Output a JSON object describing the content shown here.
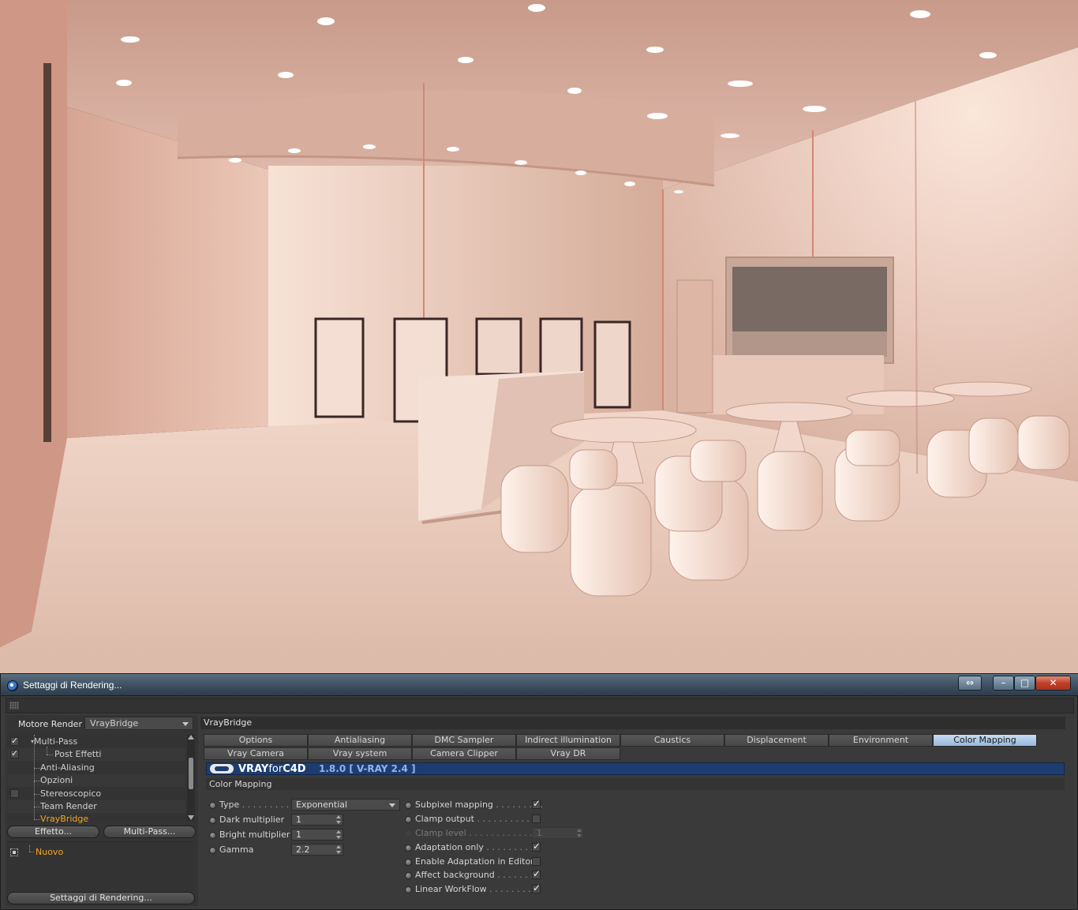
{
  "window": {
    "title": "Settaggi di Rendering..."
  },
  "left_panel": {
    "engine_label": "Motore Render",
    "engine_value": "VrayBridge",
    "tree": [
      {
        "label": "Multi-Pass",
        "checked": true
      },
      {
        "label": "Post Effetti",
        "checked": true
      },
      {
        "label": "Anti-Aliasing"
      },
      {
        "label": "Opzioni"
      },
      {
        "label": "Stereoscopico",
        "checked": false
      },
      {
        "label": "Team Render"
      },
      {
        "label": "VrayBridge",
        "selected": true
      }
    ],
    "effect_button": "Effetto...",
    "multipass_button": "Multi-Pass...",
    "preset_name": "Nuovo",
    "settings_button": "Settaggi di Rendering..."
  },
  "right_panel": {
    "header": "VrayBridge",
    "tabs_row1": [
      "Options",
      "Antialiasing",
      "DMC Sampler",
      "Indirect illumination (GI)",
      "Caustics",
      "Displacement",
      "Environment",
      "Color Mapping"
    ],
    "tabs_row2": [
      "Vray Camera",
      "Vray system",
      "Camera Clipper",
      "Vray DR"
    ],
    "active_tab": "Color Mapping",
    "banner": {
      "brand_vray": "VRAY",
      "brand_for": "for",
      "brand_c4d": "C4D",
      "version": "1.8.0  [ V-RAY 2.4 ]"
    },
    "section": "Color Mapping",
    "left_params": {
      "type_label": "Type",
      "type_dots": " . . . . . . . . . .",
      "type_value": "Exponential",
      "dark_label": "Dark multiplier",
      "dark_value": "1",
      "bright_label": "Bright multiplier",
      "bright_value": "1",
      "gamma_label": "Gamma",
      "gamma_value": "2.2"
    },
    "right_params": {
      "subpixel_label": "Subpixel mapping",
      "subpixel_dots": " . . . . . . . . .",
      "subpixel_checked": true,
      "clamp_label": "Clamp output",
      "clamp_dots": " . . . . . . . . . . . .",
      "clamp_checked": false,
      "clamp_level_label": "Clamp level",
      "clamp_level_dots": " . . . . . . . . . . . . . . .",
      "clamp_level_value": "1",
      "adapt_label": "Adaptation only",
      "adapt_dots": " . . . . . . . . . .",
      "adapt_checked": true,
      "adapt_editor_label": "Enable Adaptation in Editor",
      "adapt_editor_checked": false,
      "affect_bg_label": "Affect background",
      "affect_bg_dots": " . . . . . . . .",
      "affect_bg_checked": true,
      "linear_label": "Linear WorkFlow",
      "linear_dots": " . . . . . . . . .",
      "linear_checked": true
    }
  },
  "colors": {
    "accent_orange": "#f5a623",
    "active_tab": "#b3cbe8",
    "banner_blue": "#1d3d70",
    "render_tint": "#e8c2b2"
  }
}
